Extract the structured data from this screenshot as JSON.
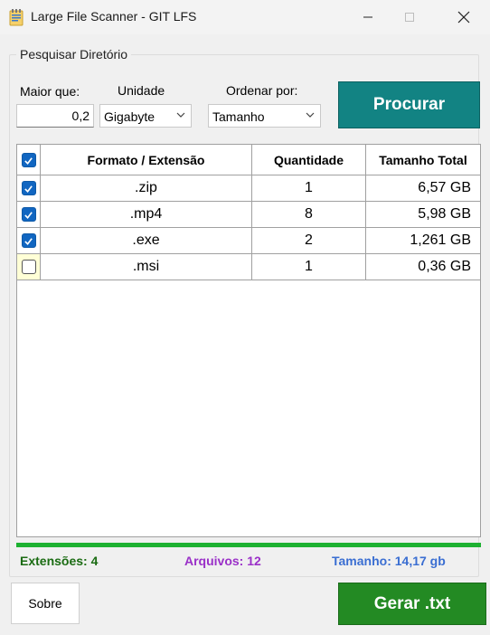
{
  "window": {
    "title": "Large File Scanner - GIT LFS",
    "icon": "notepad-app-icon"
  },
  "group": {
    "legend": "Pesquisar Diretório",
    "min_label": "Maior que:",
    "min_value": "0,2",
    "unit_label": "Unidade",
    "unit_value": "Gigabyte",
    "order_label": "Ordenar por:",
    "order_value": "Tamanho",
    "search_button": "Procurar"
  },
  "table": {
    "header_checked": true,
    "columns": [
      "Formato / Extensão",
      "Quantidade",
      "Tamanho Total"
    ],
    "rows": [
      {
        "checked": true,
        "ext": ".zip",
        "qty": "1",
        "size": "6,57 GB"
      },
      {
        "checked": true,
        "ext": ".mp4",
        "qty": "8",
        "size": "5,98 GB"
      },
      {
        "checked": true,
        "ext": ".exe",
        "qty": "2",
        "size": "1,261 GB"
      },
      {
        "checked": false,
        "ext": ".msi",
        "qty": "1",
        "size": "0,36 GB"
      }
    ]
  },
  "progress": {
    "percent": 100,
    "color": "#1db131"
  },
  "status": {
    "extensions": "Extensões: 4",
    "files": "Arquivos: 12",
    "size": "Tamanho: 14,17 gb"
  },
  "footer": {
    "about_button": "Sobre",
    "generate_button": "Gerar .txt"
  },
  "colors": {
    "search_button": "#128383",
    "generate_button": "#238a23",
    "checkbox_checked": "#1166c1"
  }
}
